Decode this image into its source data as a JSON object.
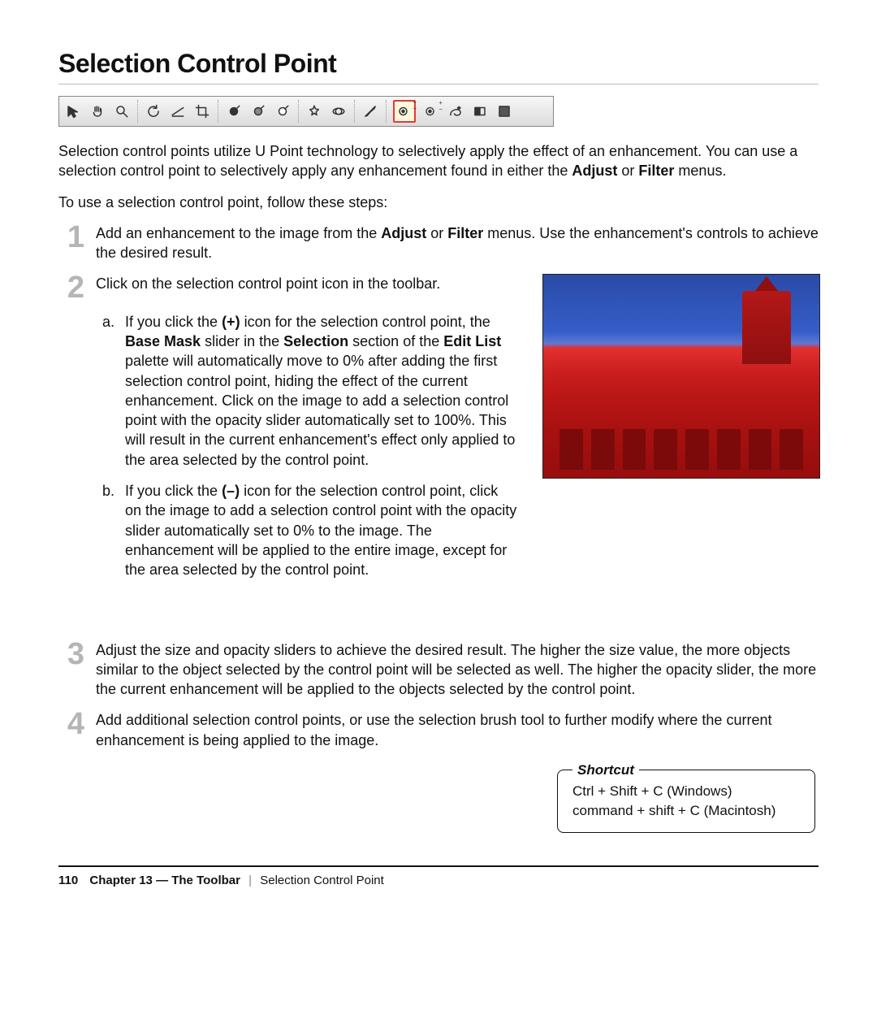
{
  "title": "Selection Control Point",
  "toolbar": {
    "icons": [
      "arrow-pointer-icon",
      "hand-pan-icon",
      "zoom-icon",
      "rotate-icon",
      "straighten-icon",
      "crop-icon",
      "black-cp-icon",
      "neutral-cp-icon",
      "white-cp-icon",
      "auto-levels-icon",
      "d-lighting-icon",
      "color-cp-icon",
      "selection-cp-plus-icon",
      "selection-cp-minus-icon",
      "lasso-plus-icon",
      "gradient-icon",
      "fill-icon"
    ],
    "highlighted_index": 12
  },
  "intro_html": "Selection control points utilize U Point technology to selectively apply the effect of an enhancement. You can use a selection control point to selectively apply any enhancement found in either the <b>Adjust</b> or <b>Filter</b> menus.",
  "lead_in": "To use a selection control point, follow these steps:",
  "steps": {
    "s1": {
      "num": "1",
      "html": "Add an enhancement to the image from the <b>Adjust</b> or <b>Filter</b> menus. Use the enhancement's controls to achieve the desired result."
    },
    "s2": {
      "num": "2",
      "text": "Click on the selection control point icon in the toolbar.",
      "a_html": "If you click the <b>(+)</b> icon for the selection control point, the <b>Base Mask</b> slider in the <b>Selection</b> section of the <b>Edit List</b> palette will automatically move to 0% after adding the first selection control point, hiding the effect of the current enhancement. Click on the image to add a selection control point with the opacity slider automatically set to 100%. This will result in the current enhancement's effect only applied to the area selected by the control point.",
      "b_html": "If you click the <b>(–)</b> icon for the selection control point, click on the image to add a selection control point with the opacity slider automatically set to 0% to the image. The enhancement will be applied to the entire image, except for the area selected by the control point."
    },
    "s3": {
      "num": "3",
      "text": "Adjust the size and opacity sliders to achieve the desired result. The higher the size value, the more objects similar to the object selected by the control point will be selected as well. The higher the opacity slider, the more the current enhancement will be applied to the objects selected by the control point."
    },
    "s4": {
      "num": "4",
      "text": "Add additional selection control points, or use the selection brush tool to further modify where the current enhancement is being applied to the image."
    }
  },
  "shortcut": {
    "legend": "Shortcut",
    "win": "Ctrl + Shift + C (Windows)",
    "mac": "command + shift + C (Macintosh)"
  },
  "footer": {
    "page": "110",
    "chapter": "Chapter 13 — The Toolbar",
    "section": "Selection Control Point"
  }
}
